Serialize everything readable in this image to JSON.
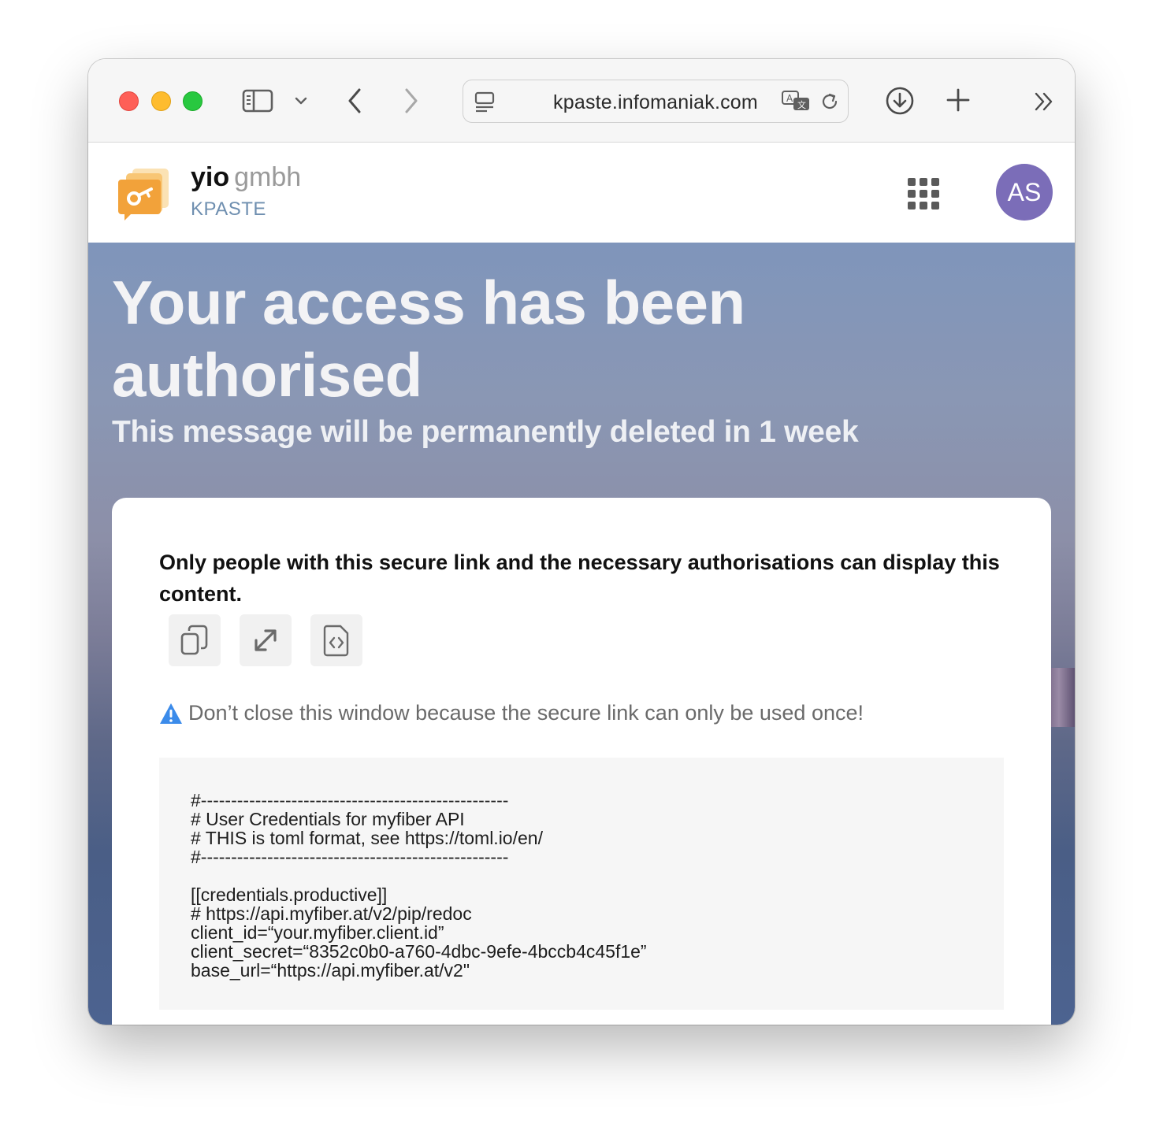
{
  "browser": {
    "url": "kpaste.infomaniak.com"
  },
  "header": {
    "brand_name": "yio",
    "brand_org": "gmbh",
    "product": "KPASTE",
    "avatar_initials": "AS"
  },
  "hero": {
    "title": "Your access has been authorised",
    "subtitle": "This message will be permanently deleted in 1 week"
  },
  "card": {
    "notice": "Only people with this secure link and the necessary authorisations can display this content.",
    "warning": "Don’t close this window because the secure link can only be used once!",
    "code_lines": [
      "#---------------------------------------------------",
      "# User Credentials for myfiber API",
      "# THIS is toml format, see https://toml.io/en/",
      "#---------------------------------------------------",
      "",
      "[[credentials.productive]]",
      "# https://api.myfiber.at/v2/pip/redoc",
      "client_id=“your.myfiber.client.id”",
      "client_secret=“8352c0b0-a760-4dbc-9efe-4bccb4c45f1e”",
      "base_url=“https://api.myfiber.at/v2\""
    ]
  },
  "colors": {
    "avatar": "#7b6db8",
    "product_label": "#6f8fb0",
    "warning_icon": "#3b8bea",
    "logo": "#f2a23a"
  }
}
